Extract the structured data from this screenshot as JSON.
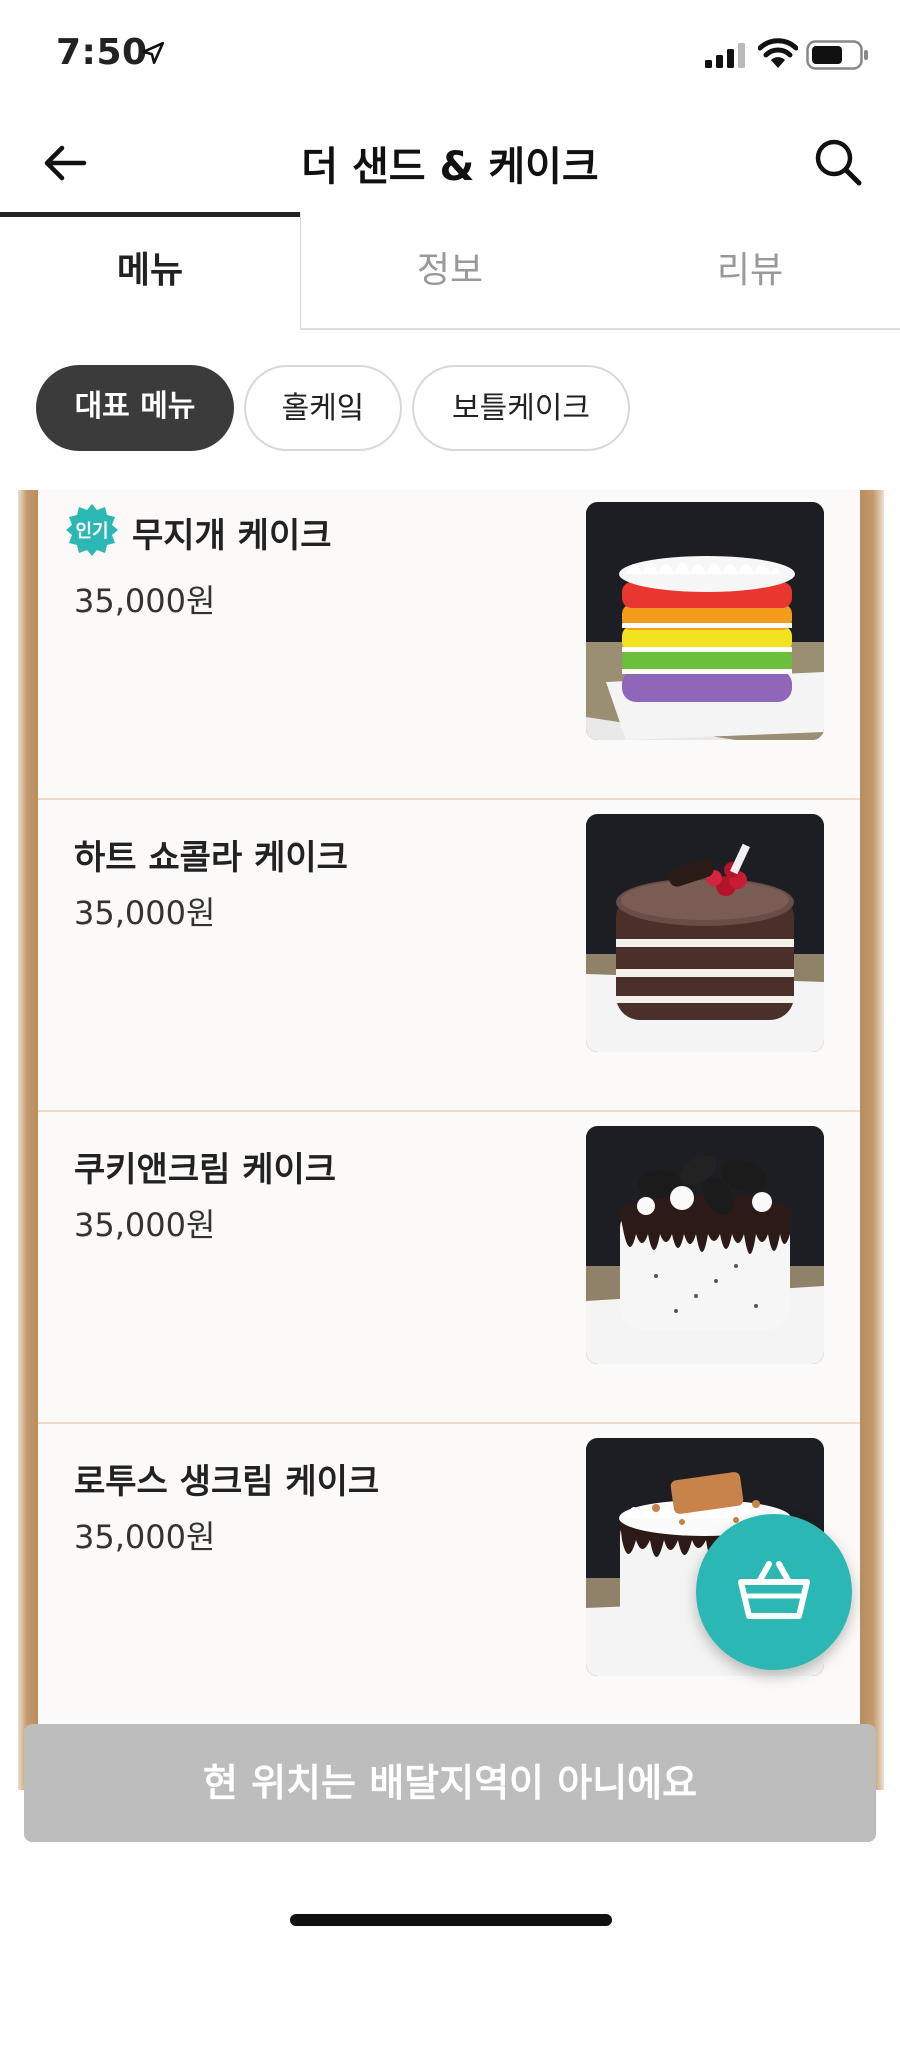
{
  "status_bar": {
    "time": "7:50"
  },
  "header": {
    "title": "더 샌드 & 케이크"
  },
  "tabs": [
    {
      "label": "메뉴",
      "active": true
    },
    {
      "label": "정보",
      "active": false
    },
    {
      "label": "리뷰",
      "active": false
    }
  ],
  "categories": [
    {
      "label": "대표 메뉴",
      "active": true
    },
    {
      "label": "홀케잌",
      "active": false
    },
    {
      "label": "보틀케이크",
      "active": false
    }
  ],
  "menu_items": [
    {
      "name": "무지개 케이크",
      "price": "35,000원",
      "badge": "인기"
    },
    {
      "name": "하트 쇼콜라 케이크",
      "price": "35,000원"
    },
    {
      "name": "쿠키앤크림 케이크",
      "price": "35,000원"
    },
    {
      "name": "로투스 생크림 케이크",
      "price": "35,000원"
    }
  ],
  "bottom_bar": {
    "label": "현 위치는 배달지역이 아니에요"
  },
  "colors": {
    "accent": "#2bb8b4",
    "chip_active": "#3b3b3b",
    "bottom_bar": "#bdbdbd",
    "frame_wood": "#c49a6c"
  },
  "icons": [
    "location-arrow-icon",
    "signal-icon",
    "wifi-icon",
    "battery-icon",
    "back-arrow-icon",
    "search-icon",
    "basket-icon"
  ]
}
